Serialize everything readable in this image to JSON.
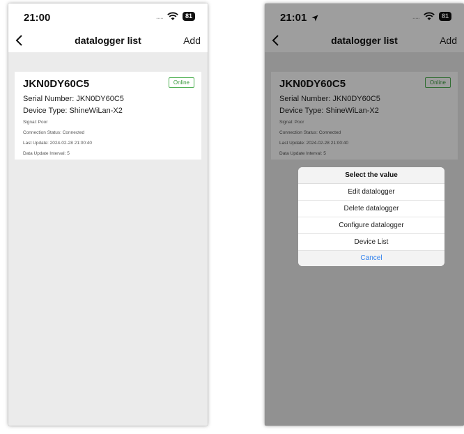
{
  "left": {
    "status": {
      "time": "21:00",
      "dots": ".....",
      "battery": "81"
    },
    "nav": {
      "title": "datalogger list",
      "add": "Add"
    },
    "card": {
      "title": "JKN0DY60C5",
      "badge": "Online",
      "serial": "Serial Number: JKN0DY60C5",
      "device_type": "Device Type: ShineWiLan-X2",
      "signal": "Signal: Poor",
      "connection": "Connection Status: Connected",
      "last_update": "Last Update: 2024-02-28 21:00:40",
      "interval": "Data Update Interval: 5"
    }
  },
  "right": {
    "status": {
      "time": "21:01",
      "dots": ".....",
      "battery": "81"
    },
    "nav": {
      "title": "datalogger list",
      "add": "Add"
    },
    "card": {
      "title": "JKN0DY60C5",
      "badge": "Online",
      "serial": "Serial Number: JKN0DY60C5",
      "device_type": "Device Type: ShineWiLan-X2",
      "signal": "Signal: Poor",
      "connection": "Connection Status: Connected",
      "last_update": "Last Update: 2024-02-28 21:00:40",
      "interval": "Data Update Interval: 5"
    },
    "sheet": {
      "title": "Select the value",
      "items": [
        "Edit datalogger",
        "Delete datalogger",
        "Configure datalogger",
        "Device List"
      ],
      "cancel": "Cancel"
    }
  },
  "colors": {
    "accent": "#2f80ed",
    "online": "#3a9a3e",
    "background": "#ebebeb"
  }
}
